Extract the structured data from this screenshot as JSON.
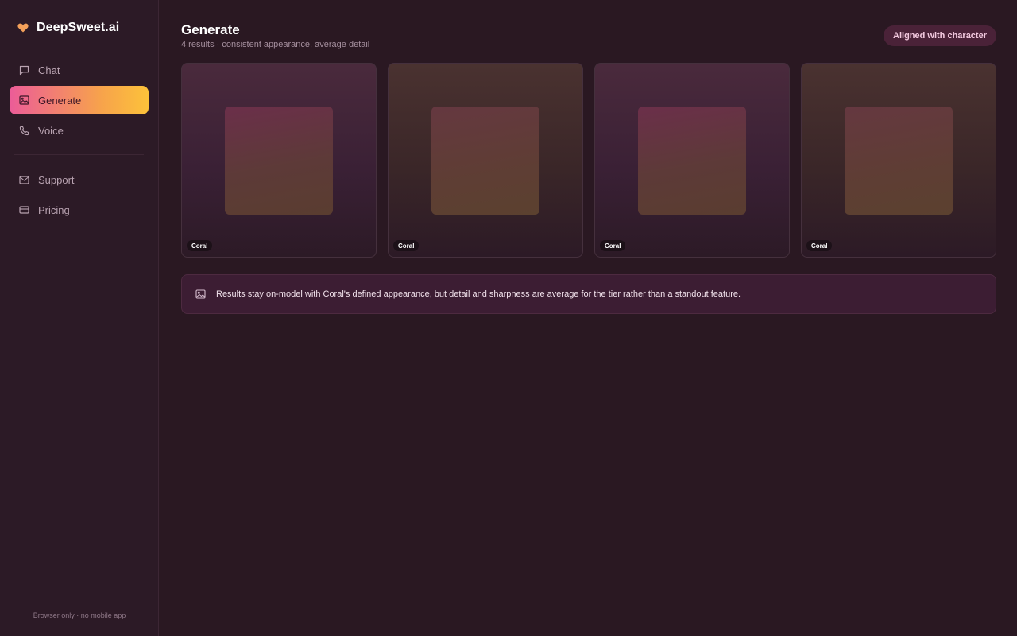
{
  "brand": {
    "name": "DeepSweet.ai",
    "icon": "heart-icon",
    "accent": "#f7a24c"
  },
  "sidebar": {
    "items": [
      {
        "label": "Chat",
        "icon": "chat-icon",
        "active": false
      },
      {
        "label": "Generate",
        "icon": "image-icon",
        "active": true
      },
      {
        "label": "Voice",
        "icon": "phone-icon",
        "active": false
      },
      {
        "label": "Support",
        "icon": "mail-icon",
        "active": false
      },
      {
        "label": "Pricing",
        "icon": "card-icon",
        "active": false
      }
    ],
    "footer": "Browser only · no mobile app"
  },
  "header": {
    "title": "Generate",
    "subtitle": "4 results · consistent appearance, average detail",
    "status": "Aligned with character"
  },
  "results": [
    {
      "tag": "Coral",
      "tone": "pink"
    },
    {
      "tag": "Coral",
      "tone": "gold"
    },
    {
      "tag": "Coral",
      "tone": "pink"
    },
    {
      "tag": "Coral",
      "tone": "gold"
    }
  ],
  "info": {
    "icon": "image-icon",
    "text": "Results stay on-model with Coral's defined appearance, but detail and sharpness are average for the tier rather than a standout feature."
  },
  "colors": {
    "background": "#2a1822",
    "sidebar": "#2c1a26",
    "active_gradient_start": "#ec5c98",
    "active_gradient_end": "#fcc23a",
    "pill": "#4a2238"
  }
}
